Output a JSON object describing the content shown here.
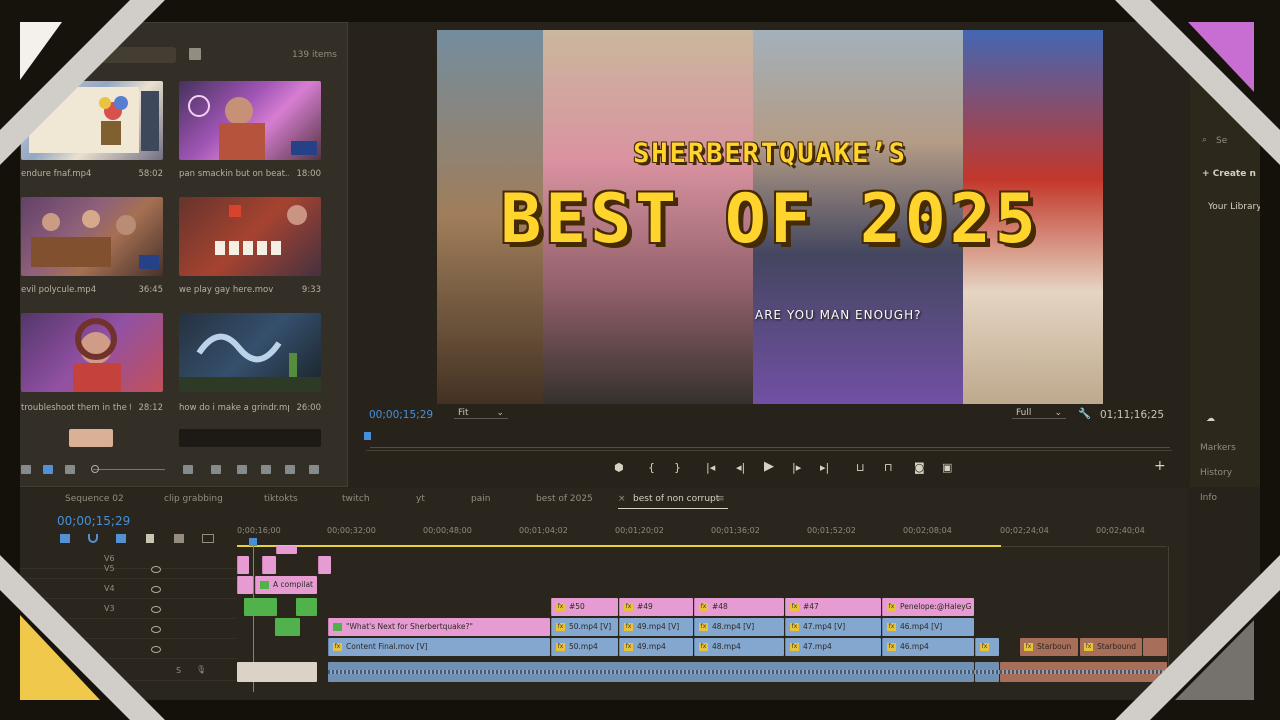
{
  "project_panel": {
    "item_count": "139 items",
    "items": [
      {
        "name": "endure fnaf.mp4",
        "duration": "58:02"
      },
      {
        "name": "pan smackin but on beat...",
        "duration": "18:00"
      },
      {
        "name": "evil polycule.mp4",
        "duration": "36:45"
      },
      {
        "name": "we play gay here.mov",
        "duration": "9:33"
      },
      {
        "name": "troubleshoot them in the f...",
        "duration": "28:12"
      },
      {
        "name": "how do i make a grindr.mp4",
        "duration": "26:00"
      }
    ]
  },
  "program_monitor": {
    "title_line1": "SHERBERTQUAKE’S",
    "title_line2": "BEST OF 2025",
    "caption": "ARE YOU MAN ENOUGH?",
    "current_timecode": "00;00;15;29",
    "fit_dropdown": "Fit",
    "quality_dropdown": "Full",
    "duration_timecode": "01;11;16;25"
  },
  "right_panel": {
    "search_placeholder": "Se",
    "create_label": "Create n",
    "library_label": "Your Library",
    "markers": "Markers",
    "history": "History",
    "info": "Info"
  },
  "timeline": {
    "tabs": [
      "Sequence 02",
      "clip grabbing",
      "tiktokts",
      "twitch",
      "yt",
      "pain",
      "best of 2025",
      "best of non corrupt"
    ],
    "active_tab": "best of non corrupt",
    "timecode": "00;00;15;29",
    "ruler": [
      "0;00;16;00",
      "00;00;32;00",
      "00;00;48;00",
      "00;01;04;02",
      "00;01;20;02",
      "00;01;36;02",
      "00;01;52;02",
      "00;02;08;04",
      "00;02;24;04",
      "00;02;40;04"
    ],
    "tracks": [
      "V6",
      "V5",
      "V4",
      "V3",
      "",
      "",
      "S"
    ],
    "clips": {
      "v4_label": "A compilat",
      "v3": [
        "#50",
        "#49",
        "#48",
        "#47",
        "Penelope:@HaleyG"
      ],
      "v2": [
        "\"What's Next for Sherbertquake?\"",
        "50.mp4 [V]",
        "49.mp4 [V]",
        "48.mp4 [V]",
        "47.mp4 [V]",
        "46.mp4 [V]"
      ],
      "v1": [
        "Content Final.mov [V]",
        "50.mp4",
        "49.mp4",
        "48.mp4",
        "47.mp4",
        "46.mp4",
        "Starboun",
        "Starbound"
      ]
    }
  },
  "colors": {
    "accent_blue": "#3e8de0",
    "pink_clip": "#e59ad8",
    "blue_clip": "#7ea6d6",
    "title_yellow": "#ffd52a"
  }
}
